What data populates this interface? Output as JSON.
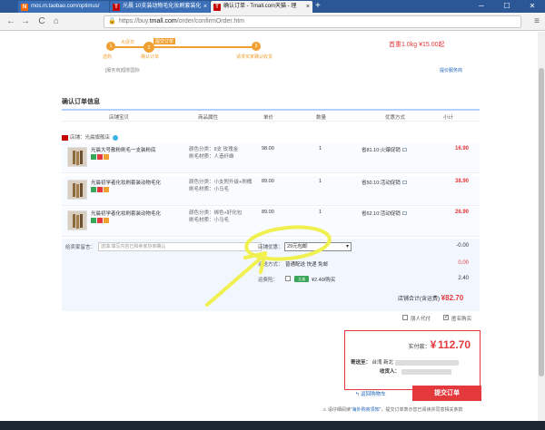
{
  "browser": {
    "tabs": [
      {
        "label": "mos.m.taobao.com/optimus/",
        "favicon": "N",
        "color": "#ff6a00"
      },
      {
        "label": "光晨 10支装动物毛化妆刷套装化",
        "favicon": "T",
        "color": "#c40000"
      },
      {
        "label": "确认订单 - Tmall.com天猫 - 理",
        "favicon": "T",
        "color": "#c40000"
      }
    ],
    "new_tab": "+",
    "url_prefix": "https://buy.",
    "url_domain": "tmall.com",
    "url_path": "/order/confirmOrder.htm",
    "win_min": "─",
    "win_max": "☐",
    "win_close": "✕",
    "back": "←",
    "forward": "→",
    "reload": "C",
    "home": "⌂",
    "menu": "≡"
  },
  "progress": {
    "steps": [
      {
        "num": "1",
        "label": "大促日"
      },
      {
        "num": "2",
        "label": "提交订单"
      },
      {
        "num": "3",
        "label": "付款成功"
      }
    ],
    "bottom_labels": [
      "选购",
      "确认订单",
      "请求买家确认收货"
    ],
    "weight": "首重1.0kg ¥15.00起"
  },
  "service_left": "[服务商]理想国际",
  "service_right": "提价服务商",
  "section_title": "确认订单信息",
  "table_headers": [
    "店铺宝贝",
    "商品属性",
    "单价",
    "数量",
    "优惠方式",
    "小计"
  ],
  "shop_name": "店铺：光晨旗舰店",
  "products": [
    {
      "name": "光晨大号散粉刷毛一支装粉底",
      "attr1": "颜色分类：8支 玫瑰金",
      "attr2": "刷毛材质：人造纤维",
      "price": "98.00",
      "qty": "1",
      "discount": "省81.10:火爆促销",
      "subtotal": "16.90"
    },
    {
      "name": "光晨初学者化妆刷套装动物毛化",
      "attr1": "颜色分类：小支附升级+刷桶",
      "attr2": "刷毛材质：小马毛",
      "price": "89.00",
      "qty": "1",
      "discount": "省50.10:活动促销",
      "subtotal": "38.90"
    },
    {
      "name": "光晨初学者化妆刷套装动物毛化",
      "attr1": "颜色分类：绑色+好化包",
      "attr2": "刷毛材质：小马毛",
      "price": "89.00",
      "qty": "1",
      "discount": "省62.10:活动促销",
      "subtotal": "26.90"
    }
  ],
  "message_label": "给卖家留言：",
  "message_placeholder": "选填:填写内容已和卖家协商确认",
  "shop_discount_label": "店铺优惠：",
  "shop_discount_value": "29元包邮",
  "shop_discount_amount": "-0.00",
  "shipping_label": "运送方式：",
  "shipping_value": "普通配送 快递 免邮",
  "shipping_amount": "0.00",
  "insurance_label": "运费险：",
  "insurance_tag": "立减",
  "insurance_value": "¥2.40/购买",
  "insurance_amount": "2.40",
  "store_total_label": "店铺合计(含运费)",
  "store_total_value": "¥82.70",
  "anon_label": "匿名购买",
  "agent_label": "朋人代付",
  "pay_label": "实付款：",
  "pay_currency": "¥",
  "pay_amount": "112.70",
  "ship_to_label": "寄送至：",
  "ship_to_value": "台湾 新北",
  "receiver_label": "收货人：",
  "back_cart": "返回购物车",
  "submit": "提交订单",
  "notice_prefix": "请仔细阅读",
  "notice_link": "\"海外购商须知\"",
  "notice_suffix": "，提交订单表示您已阅读并同意相关条款",
  "accent": "#e4393c",
  "annotation_color": "#f0f050"
}
